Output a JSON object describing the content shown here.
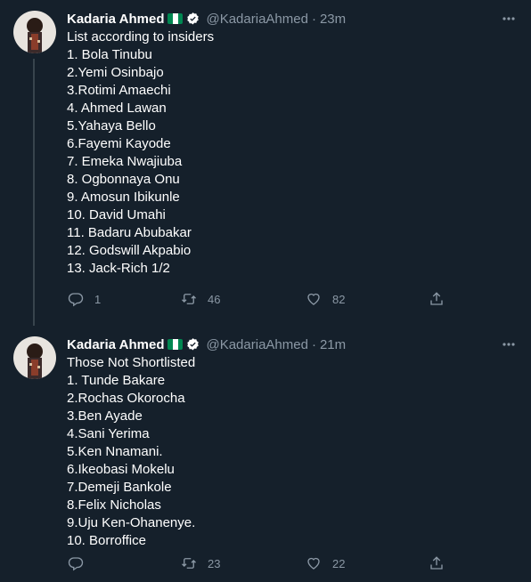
{
  "tweets": [
    {
      "author_name": "Kadaria Ahmed",
      "handle": "@KadariaAhmed",
      "separator": "·",
      "time": "23m",
      "lines": [
        "List according to insiders",
        "1. Bola Tinubu",
        "2.Yemi Osinbajo",
        "3.Rotimi Amaechi",
        "4. Ahmed Lawan",
        "5.Yahaya Bello",
        "6.Fayemi Kayode",
        "7. Emeka Nwajiuba",
        "8. Ogbonnaya Onu",
        "9. Amosun Ibikunle",
        "10. David Umahi",
        "11. Badaru Abubakar",
        "12. Godswill Akpabio",
        "13. Jack-Rich 1/2"
      ],
      "replies": "1",
      "retweets": "46",
      "likes": "82"
    },
    {
      "author_name": "Kadaria Ahmed",
      "handle": "@KadariaAhmed",
      "separator": "·",
      "time": "21m",
      "lines": [
        "Those Not Shortlisted",
        "1. Tunde Bakare",
        "2.Rochas Okorocha",
        "3.Ben Ayade",
        "4.Sani Yerima",
        "5.Ken Nnamani.",
        "6.Ikeobasi Mokelu",
        "7.Demeji Bankole",
        "8.Felix Nicholas",
        "9.Uju Ken-Ohanenye.",
        "10. Borroffice"
      ],
      "replies": "",
      "retweets": "23",
      "likes": "22"
    }
  ],
  "colors": {
    "background": "#15202b",
    "text": "#ffffff",
    "secondary_text": "#8b98a5",
    "verified_badge": "#ffffff",
    "thread_line": "#38444d"
  },
  "icons": {
    "verified": "verified-badge-icon",
    "flag": "nigeria-flag-icon",
    "more": "more-options-icon",
    "reply": "reply-icon",
    "retweet": "retweet-icon",
    "like": "like-icon",
    "share": "share-icon"
  }
}
